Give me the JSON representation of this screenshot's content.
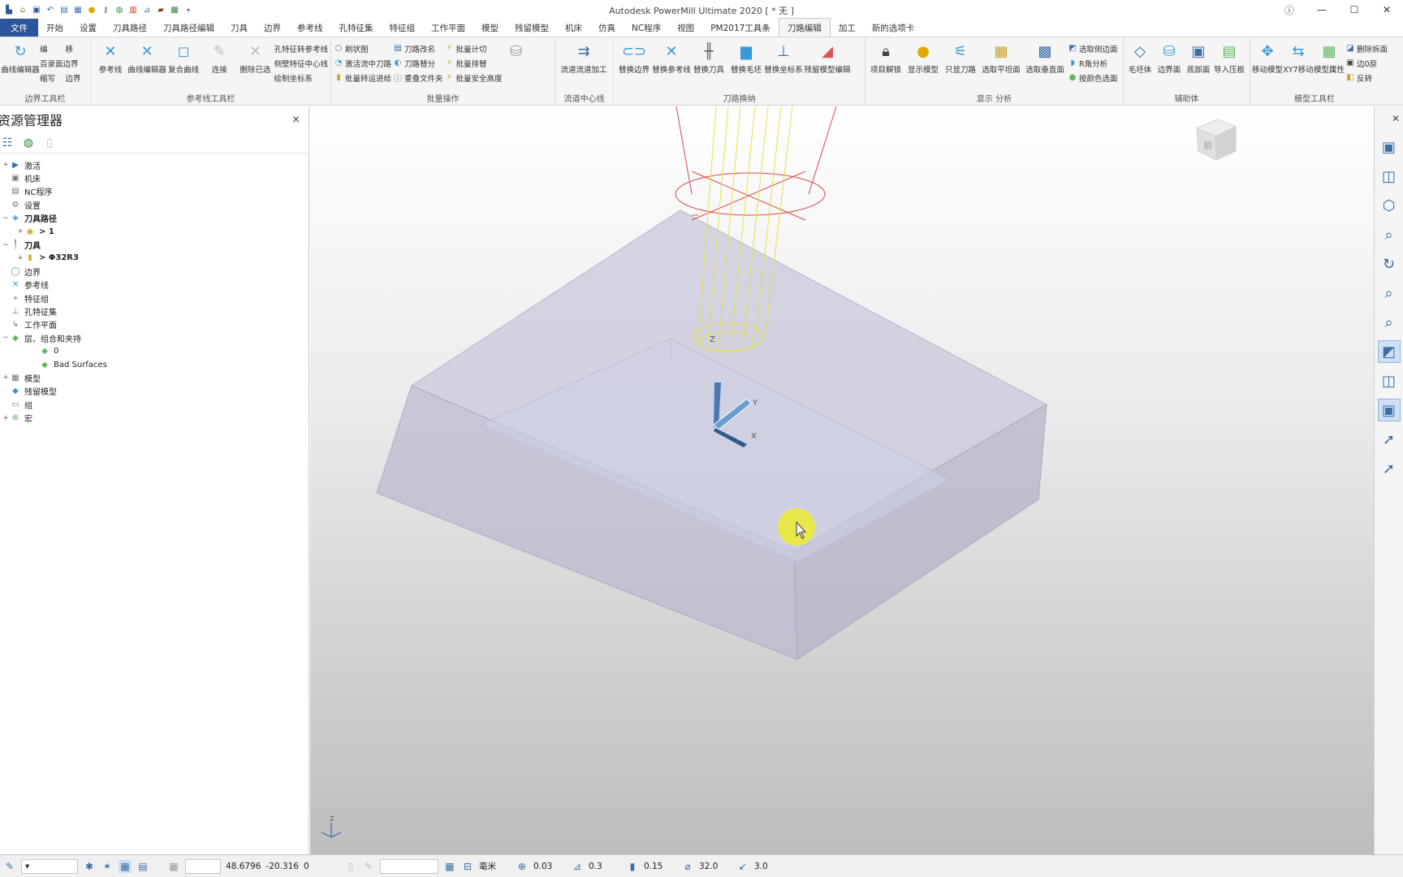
{
  "app": {
    "title": "Autodesk PowerMill Ultimate 2020   [ * 无 ]"
  },
  "tabs": [
    "文件",
    "开始",
    "设置",
    "刀具路径",
    "刀具路径编辑",
    "刀具",
    "边界",
    "参考线",
    "孔特征集",
    "特征组",
    "工作平面",
    "模型",
    "残留模型",
    "机床",
    "仿真",
    "NC程序",
    "视图",
    "PM2017工具条",
    "刀路编辑",
    "加工",
    "新的选项卡"
  ],
  "active_tab": "刀路编辑",
  "ribbon": {
    "g1": {
      "label": "边界工具栏",
      "big": "曲线编辑器",
      "small": [
        "编",
        "移",
        "百录面边界",
        "缩写",
        "边界"
      ]
    },
    "g2": {
      "label": "参考线工具栏",
      "big": [
        "参考线",
        "曲线编辑器",
        "复合曲线",
        "连接",
        "删除已选"
      ],
      "small": [
        "孔特征转参考线",
        "侧壁特征中心线",
        "绘制坐标系"
      ]
    },
    "g3": {
      "label": "批量操作",
      "small": [
        "刷状图",
        "激活流中刀路",
        "批量转运进给",
        "刀路改名",
        "刀路替分",
        "重叠文件夹",
        "批量计切",
        "批量排替",
        "批量安全高度"
      ]
    },
    "g4": {
      "label": "流道中心线",
      "big": [
        "流道流道加工"
      ]
    },
    "g5": {
      "label": "刀路换纳",
      "big": [
        "替换边界",
        "替换参考线",
        "替换刀具",
        "替换毛坯",
        "替换坐标系",
        "残留模型编辑"
      ]
    },
    "g6": {
      "label": "显示 分析",
      "big": [
        "项目解锁",
        "显示模型",
        "只显刀路",
        "选取平坦面",
        "选取垂直面"
      ],
      "small": [
        "选取侧边面",
        "R角分析",
        "按颜色选面"
      ]
    },
    "g7": {
      "label": "辅助体",
      "big": [
        "毛坯体",
        "边界面",
        "底部面",
        "导入压板"
      ]
    },
    "g8": {
      "label": "模型工具栏",
      "big": [
        "移动模型",
        "XY7移动",
        "模型属性"
      ],
      "small": [
        "删除拆面",
        "边0原",
        "反转"
      ]
    }
  },
  "explorer": {
    "title": "资源管理器",
    "close": "×",
    "tree": [
      {
        "label": "激活",
        "exp": "+",
        "icon": "▶",
        "color": "#2b6cb0"
      },
      {
        "label": "机床",
        "exp": "",
        "icon": "▣",
        "color": "#777"
      },
      {
        "label": "NC程序",
        "exp": "",
        "icon": "▤",
        "color": "#777"
      },
      {
        "label": "设置",
        "exp": "",
        "icon": "⚙",
        "color": "#777"
      },
      {
        "label": "刀具路径",
        "exp": "−",
        "icon": "◈",
        "color": "#3a9ad9",
        "bold": true
      },
      {
        "label": "> 1",
        "exp": "+",
        "icon": "◉",
        "color": "#c9a227",
        "indent": 1,
        "bold": true
      },
      {
        "label": "刀具",
        "exp": "−",
        "icon": "╿",
        "color": "#888",
        "bold": true
      },
      {
        "label": "> Φ32R3",
        "exp": "+",
        "icon": "▮",
        "color": "#d4b32a",
        "indent": 1,
        "bold": true
      },
      {
        "label": "边界",
        "exp": "",
        "icon": "◯",
        "color": "#3a9ad9"
      },
      {
        "label": "参考线",
        "exp": "",
        "icon": "✕",
        "color": "#3a9ad9"
      },
      {
        "label": "特征组",
        "exp": "",
        "icon": "⌖",
        "color": "#777"
      },
      {
        "label": "孔特征集",
        "exp": "",
        "icon": "⊥",
        "color": "#777"
      },
      {
        "label": "工作平面",
        "exp": "",
        "icon": "↳",
        "color": "#777"
      },
      {
        "label": "层、组合和夹持",
        "exp": "−",
        "icon": "◆",
        "color": "#5cb85c"
      },
      {
        "label": "0",
        "exp": "",
        "icon": "◆",
        "color": "#5cb85c",
        "indent": 2
      },
      {
        "label": "Bad Surfaces",
        "exp": "",
        "icon": "◆",
        "color": "#5cb85c",
        "indent": 2
      },
      {
        "label": "模型",
        "exp": "+",
        "icon": "▦",
        "color": "#777"
      },
      {
        "label": "残留模型",
        "exp": "",
        "icon": "◆",
        "color": "#3a9ad9"
      },
      {
        "label": "组",
        "exp": "",
        "icon": "▭",
        "color": "#777"
      },
      {
        "label": "宏",
        "exp": "+",
        "icon": "⊕",
        "color": "#5cb85c"
      }
    ]
  },
  "viewport": {
    "viewcube": "前",
    "axis_labels": {
      "x": "X",
      "y": "Y",
      "z": "Z"
    }
  },
  "statusbar": {
    "x": "48.6796",
    "y": "-20.316",
    "z": "0",
    "units": "毫米",
    "tol": "0.03",
    "thick": "0.3",
    "step": "0.15",
    "dia": "32.0",
    "angle": "3.0"
  }
}
